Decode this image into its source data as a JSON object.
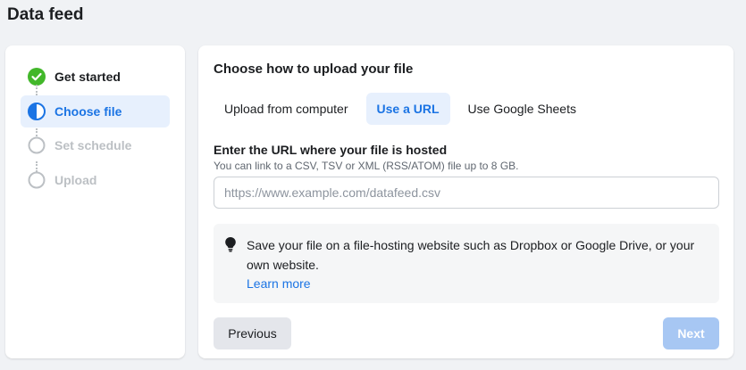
{
  "page": {
    "title": "Data feed"
  },
  "steps": [
    {
      "label": "Get started",
      "state": "done"
    },
    {
      "label": "Choose file",
      "state": "active"
    },
    {
      "label": "Set schedule",
      "state": "pending"
    },
    {
      "label": "Upload",
      "state": "pending"
    }
  ],
  "main": {
    "title": "Choose how to upload your file",
    "tabs": [
      {
        "label": "Upload from computer",
        "selected": false
      },
      {
        "label": "Use a URL",
        "selected": true
      },
      {
        "label": "Use Google Sheets",
        "selected": false
      }
    ],
    "url_field": {
      "label": "Enter the URL where your file is hosted",
      "help": "You can link to a CSV, TSV or XML (RSS/ATOM) file up to 8 GB.",
      "placeholder": "https://www.example.com/datafeed.csv",
      "value": ""
    },
    "tip": {
      "icon": "lightbulb-icon",
      "text": "Save your file on a file-hosting website such as Dropbox or Google Drive, or your own website.",
      "link": "Learn more"
    },
    "buttons": {
      "previous": "Previous",
      "next": "Next"
    }
  },
  "colors": {
    "accent": "#1b74e4",
    "success": "#42b72a",
    "active_bg": "#e7f0fd",
    "next_disabled": "#a7c7f3",
    "background": "#f0f2f5"
  }
}
